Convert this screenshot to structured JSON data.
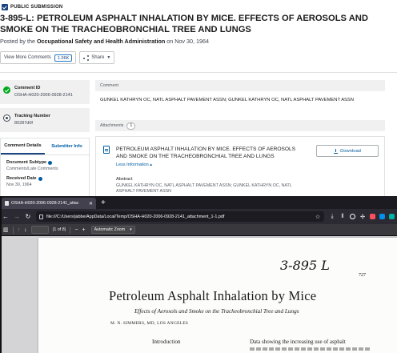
{
  "regulations": {
    "badge": "PUBLIC SUBMISSION",
    "title": "3-895-L: PETROLEUM ASPHALT INHALATION BY MICE. EFFECTS OF AEROSOLS AND SMOKE ON THE TRACHEOBRONCHIAL TREE AND LUNGS",
    "posted_prefix": "Posted by the",
    "posted_agency": "Occupational Safety and Health Administration",
    "posted_date": "on Nov 30, 1964",
    "view_more_label": "View More Comments",
    "view_more_count": "1.06K",
    "share_label": "Share",
    "comment_id_label": "Comment ID",
    "comment_id_value": "OSHA-H020-2006-0928-2141",
    "tracking_label": "Tracking Number",
    "tracking_value": "80287d0f",
    "tab_comment_details": "Comment Details",
    "tab_submitter_info": "Submitter Info",
    "doc_subtype_label": "Document Subtype",
    "doc_subtype_value": "Comments/Late Comments",
    "received_label": "Received Date",
    "received_value": "Nov 30, 1964",
    "comment_section_label": "Comment",
    "comment_text": "GUNKEL KATHRYN OC, NATL ASPHALT PAVEMENT ASSN; GUNKEL KATHRYN OC, NATL ASPHALT PAVEMENT ASSN",
    "attachments_label": "Attachments",
    "attachments_count": "1",
    "attachment_title": "PETROLEUM ASPHALT INHALATION BY MICE. EFFECTS OF AEROSOLS AND SMOKE ON THE TRACHEOBRONCHIAL TREE AND LUNGS",
    "less_info": "Less Information",
    "download_label": "Download",
    "abstract_label": "Abstract",
    "abstract_text": "GUNKEL KATHRYN OC, NATL ASPHALT PAVEMENT ASSN; GUNKEL KATHRYN OC, NATL ASPHALT PAVEMENT ASSN"
  },
  "browser": {
    "tab_title": "OSHA-H020-2006-0928-2141_attac",
    "new_tab": "+",
    "url": "file:///C:/Users/jabbe/AppData/Local/Temp/OSHA-H020-2006-0928-2141_attachment_1-1.pdf",
    "page_of": "(1 of 8)",
    "zoom": "Automatic Zoom",
    "page_value": ""
  },
  "pdf_page": {
    "handwritten": "3-895 L",
    "page_number": "727",
    "title": "Petroleum Asphalt Inhalation by Mice",
    "subtitle": "Effects of Aerosols and Smoke on the Tracheobronchial Tree and Lungs",
    "author": "M. N. SIMMERS, MD, LOS ANGELES",
    "intro_heading": "Introduction",
    "body_start": "Data showing the increasing use of asphalt"
  },
  "colors": {
    "accent": "#1a4480",
    "link": "#005ea2",
    "success": "#00a91c",
    "browser_dark": "#1c1b22",
    "browser_toolbar": "#2b2a33",
    "pdf_toolbar": "#38383d"
  }
}
